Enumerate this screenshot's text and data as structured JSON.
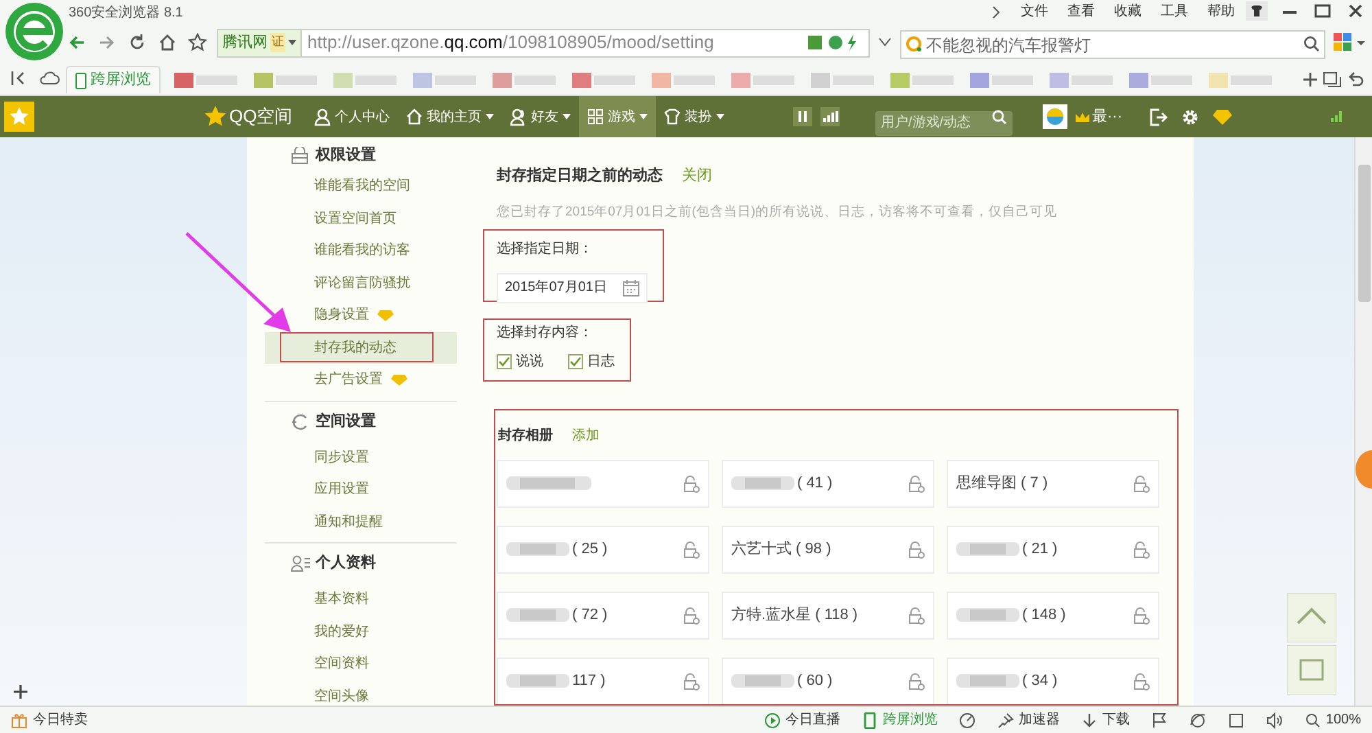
{
  "browser": {
    "title": "360安全浏览器 8.1",
    "menu": [
      "文件",
      "查看",
      "收藏",
      "工具",
      "帮助"
    ],
    "address": {
      "site": "腾讯网",
      "cert": "证",
      "url_prefix": "http://user.qzone.",
      "url_host": "qq.com",
      "url_path": "/1098108905/mood/setting"
    },
    "search": {
      "placeholder": "不能忽视的汽车报警灯"
    },
    "tabs": [
      {
        "label": "跨屏浏览",
        "selected": false
      }
    ]
  },
  "nav": {
    "logo": "QQ空间",
    "items": [
      {
        "label": "个人中心",
        "dropdown": false,
        "selected": false
      },
      {
        "label": "我的主页",
        "dropdown": true,
        "selected": false
      },
      {
        "label": "好友",
        "dropdown": true,
        "selected": false
      },
      {
        "label": "游戏",
        "dropdown": true,
        "selected": true
      },
      {
        "label": "装扮",
        "dropdown": true,
        "selected": false
      }
    ],
    "search": {
      "placeholder": "用户/游戏/动态"
    },
    "user": "最···"
  },
  "sidebar": [
    {
      "title": "权限设置",
      "items": [
        {
          "label": "谁能看我的空间",
          "vip": false,
          "selected": false
        },
        {
          "label": "设置空间首页",
          "vip": false,
          "selected": false
        },
        {
          "label": "谁能看我的访客",
          "vip": false,
          "selected": false
        },
        {
          "label": "评论留言防骚扰",
          "vip": false,
          "selected": false
        },
        {
          "label": "隐身设置",
          "vip": true,
          "selected": false
        },
        {
          "label": "封存我的动态",
          "vip": false,
          "selected": true
        },
        {
          "label": "去广告设置",
          "vip": true,
          "selected": false
        }
      ]
    },
    {
      "title": "空间设置",
      "items": [
        {
          "label": "同步设置",
          "vip": false,
          "selected": false
        },
        {
          "label": "应用设置",
          "vip": false,
          "selected": false
        },
        {
          "label": "通知和提醒",
          "vip": false,
          "selected": false
        }
      ]
    },
    {
      "title": "个人资料",
      "items": [
        {
          "label": "基本资料",
          "vip": false,
          "selected": false
        },
        {
          "label": "我的爱好",
          "vip": false,
          "selected": false
        },
        {
          "label": "空间资料",
          "vip": false,
          "selected": false
        },
        {
          "label": "空间头像",
          "vip": false,
          "selected": false
        }
      ]
    }
  ],
  "main": {
    "title": "封存指定日期之前的动态",
    "close_link": "关闭",
    "note": "您已封存了2015年07月01日之前(包含当日)的所有说说、日志，访客将不可查看，仅自己可见",
    "date_label": "选择指定日期：",
    "date_value": "2015年07月01日",
    "content_label": "选择封存内容：",
    "checkboxes": [
      {
        "label": "说说",
        "checked": true
      },
      {
        "label": "日志",
        "checked": true
      }
    ],
    "albums_title": "封存相册",
    "add_link": "添加",
    "albums": [
      {
        "blurred": true
      },
      {
        "text": "( 41 )",
        "blurred": true
      },
      {
        "text": "思维导图 ( 7 )",
        "blurred": false
      },
      {
        "text": "( 25 )",
        "blurred": true
      },
      {
        "text": "六艺十式 ( 98 )",
        "blurred": false
      },
      {
        "text": "( 21 )",
        "blurred": true
      },
      {
        "text": "( 72 )",
        "blurred": true
      },
      {
        "text": "方特.蓝水星 ( 118 )",
        "blurred": false
      },
      {
        "text": "( 148 )",
        "blurred": true
      },
      {
        "text": "117 )",
        "blurred": true
      },
      {
        "text": "( 60 )",
        "blurred": true
      },
      {
        "text": "( 34 )",
        "blurred": true
      }
    ]
  },
  "status_bar": {
    "left": "今日特卖",
    "items": [
      {
        "kind": "live",
        "label": "今日直播"
      },
      {
        "kind": "phone",
        "label": "跨屏浏览"
      },
      {
        "kind": "gauge"
      },
      {
        "kind": "pin",
        "label": "加速器"
      },
      {
        "kind": "download",
        "label": "下载"
      },
      {
        "kind": "flag"
      },
      {
        "kind": "globe"
      },
      {
        "kind": "window"
      },
      {
        "kind": "speaker"
      },
      {
        "kind": "zoom",
        "label": "100%"
      }
    ]
  }
}
